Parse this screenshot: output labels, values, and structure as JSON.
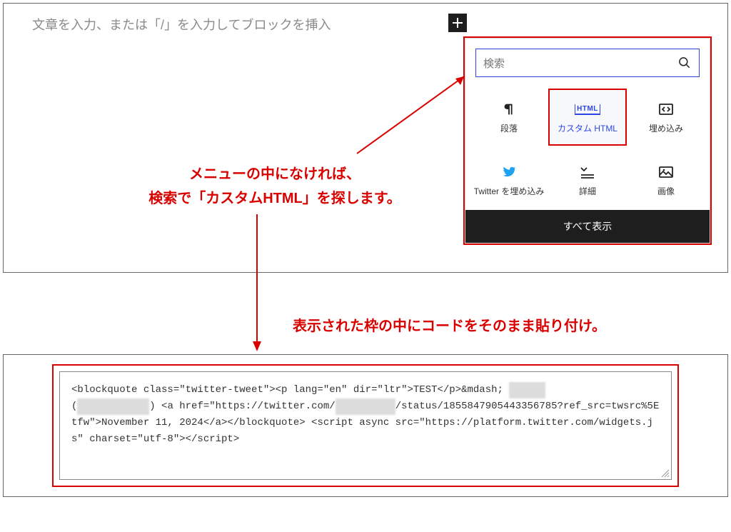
{
  "editor": {
    "placeholder": "文章を入力、または「/」を入力してブロックを挿入"
  },
  "popover": {
    "search_placeholder": "検索",
    "blocks": {
      "paragraph": "段落",
      "custom_html": "カスタム HTML",
      "embed": "埋め込み",
      "twitter": "Twitter を埋め込み",
      "details": "詳細",
      "image": "画像"
    },
    "show_all": "すべて表示",
    "html_badge": "HTML"
  },
  "annotations": {
    "line1": "メニューの中になければ、",
    "line2": "検索で「カスタムHTML」を探します。",
    "line3": "表示された枠の中にコードをそのまま貼り付け。"
  },
  "code": {
    "seg1": "<blockquote class=\"twitter-tweet\"><p lang=\"en\" dir=\"ltr\">TEST</p>&mdash; ",
    "blur1": "██████",
    "seg2": "(",
    "blur2": "█████/██████",
    "seg3": ") <a href=\"https://twitter.com/",
    "blur3": "██████████",
    "seg4": "/status/1855847905443356785?ref_src=twsrc%5Etfw\">November 11, 2024</a></blockquote> <script async src=\"https://platform.twitter.com/widgets.js\" charset=\"utf-8\"></script>"
  }
}
